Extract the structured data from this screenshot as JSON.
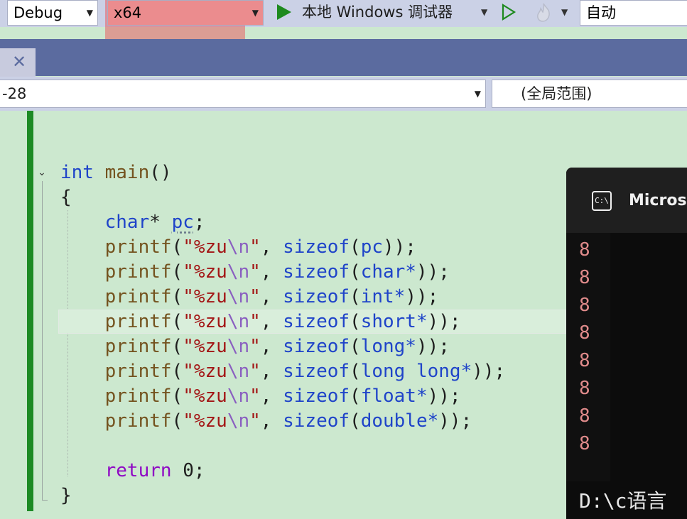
{
  "toolbar": {
    "config": "Debug",
    "platform": "x64",
    "debugger_label": "本地 Windows 调试器",
    "auto_label": "自动",
    "accent": "#1e8a1e"
  },
  "tab": {
    "close_glyph": "✕"
  },
  "navbar": {
    "location": "-28",
    "scope": "(全局范围)"
  },
  "code": {
    "line_main_kw": "int",
    "line_main_fn": "main",
    "open_brace": "{",
    "decl_type": "char",
    "decl_var": "pc",
    "printf_name": "printf",
    "fmt_prefix": "\"%zu",
    "fmt_escape": "\\n",
    "fmt_suffix": "\"",
    "sizeof_name": "sizeof",
    "args": [
      "pc",
      "char*",
      "int*",
      "short*",
      "long*",
      "long long*",
      "float*",
      "double*"
    ],
    "return_kw": "return",
    "return_val": "0",
    "close_brace": "}"
  },
  "console": {
    "title": "Microsoft",
    "outputs": [
      "8",
      "8",
      "8",
      "8",
      "8",
      "8",
      "8",
      "8"
    ],
    "prompt": "D:\\c语言"
  }
}
